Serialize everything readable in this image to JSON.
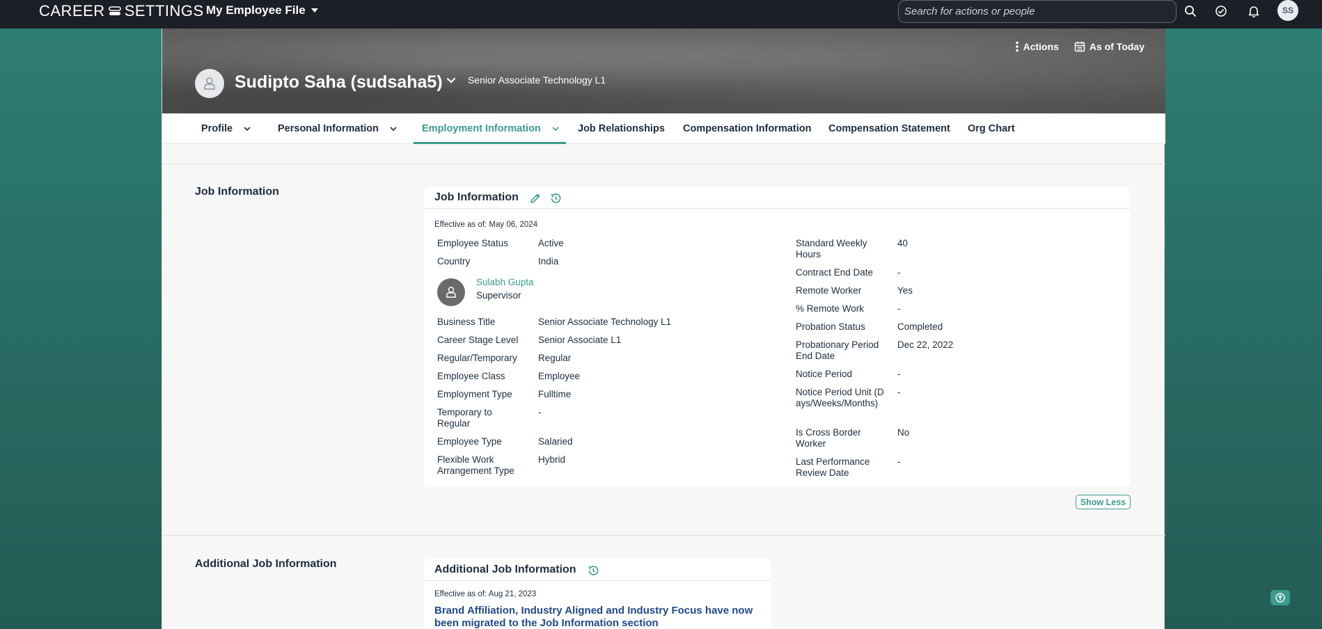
{
  "shell": {
    "logo_left": "CAREER",
    "logo_right": "SETTINGS",
    "file_menu": "My Employee File",
    "search_placeholder": "Search for actions or people",
    "avatar_initials": "SS"
  },
  "header": {
    "actions_label": "Actions",
    "as_of_label": "As of Today",
    "employee_name": "Sudipto Saha (sudsaha5)",
    "employee_title": "Senior Associate Technology L1"
  },
  "tabs": [
    {
      "label": "Profile",
      "has_menu": true
    },
    {
      "label": "Personal Information",
      "has_menu": true
    },
    {
      "label": "Employment Information",
      "has_menu": true,
      "active": true
    },
    {
      "label": "Job Relationships"
    },
    {
      "label": "Compensation Information"
    },
    {
      "label": "Compensation Statement"
    },
    {
      "label": "Org Chart"
    }
  ],
  "job_info": {
    "section_title": "Job Information",
    "card_title": "Job Information",
    "effective": "Effective as of: May 06, 2024",
    "left_top": [
      {
        "label": "Employee Status",
        "value": "Active"
      },
      {
        "label": "Country",
        "value": "India"
      }
    ],
    "supervisor": {
      "name": "Sulabh Gupta",
      "role": "Supervisor"
    },
    "left_bottom": [
      {
        "label": "Business Title",
        "value": "Senior Associate Technology L1"
      },
      {
        "label": "Career Stage Level",
        "value": "Senior Associate L1"
      },
      {
        "label": "Regular/Temporary",
        "value": "Regular"
      },
      {
        "label": "Employee Class",
        "value": "Employee"
      },
      {
        "label": "Employment Type",
        "value": "Fulltime"
      },
      {
        "label": "Temporary to Regular",
        "value": "-"
      },
      {
        "label": "Employee Type",
        "value": "Salaried"
      },
      {
        "label": "Flexible Work Arrangement Type",
        "value": "Hybrid"
      }
    ],
    "right": [
      {
        "label": "Standard Weekly Hours",
        "value": "40"
      },
      {
        "label": "Contract End Date",
        "value": "-"
      },
      {
        "label": "Remote Worker",
        "value": "Yes"
      },
      {
        "label": "% Remote Work",
        "value": "-"
      },
      {
        "label": "Probation Status",
        "value": "Completed"
      },
      {
        "label": "Probationary Period End Date",
        "value": "Dec 22, 2022"
      },
      {
        "label": "Notice Period",
        "value": "-"
      },
      {
        "label": "Notice Period Unit (Days/Weeks/Months)",
        "value": "-"
      },
      {
        "label": "Is Cross Border Worker",
        "value": "No"
      },
      {
        "label": "Last Performance Review Date",
        "value": "-"
      }
    ],
    "show_less": "Show Less"
  },
  "additional_job_info": {
    "section_title": "Additional Job Information",
    "card_title": "Additional Job Information",
    "effective": "Effective as of: Aug 21, 2023",
    "notice": "Brand Affiliation, Industry Aligned and Industry Focus have now been migrated to the Job Information section"
  },
  "colors": {
    "accent": "#3a9b8e",
    "shell_bg": "#1d1f26",
    "link_blue": "#204a8a",
    "background_teal": "#2f7f74"
  }
}
